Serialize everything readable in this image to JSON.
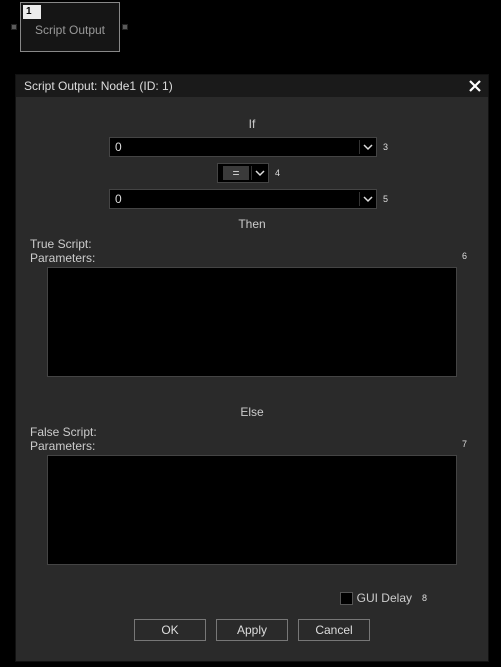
{
  "node": {
    "index": "1",
    "label": "Script Output"
  },
  "dialog": {
    "title": "Script Output: Node1 (ID: 1)",
    "rownums": {
      "r3": "3",
      "r4": "4",
      "r5": "5",
      "r6": "6",
      "r7": "7",
      "r8": "8"
    },
    "if": {
      "header": "If",
      "operand1": "0",
      "operator": "=",
      "operand2": "0"
    },
    "then": {
      "header": "Then",
      "label": "True Script:",
      "params_label": "Parameters:",
      "value": ""
    },
    "else": {
      "header": "Else",
      "label": "False Script:",
      "params_label": "Parameters:",
      "value": ""
    },
    "gui_delay_label": "GUI Delay",
    "buttons": {
      "ok": "OK",
      "apply": "Apply",
      "cancel": "Cancel"
    }
  }
}
